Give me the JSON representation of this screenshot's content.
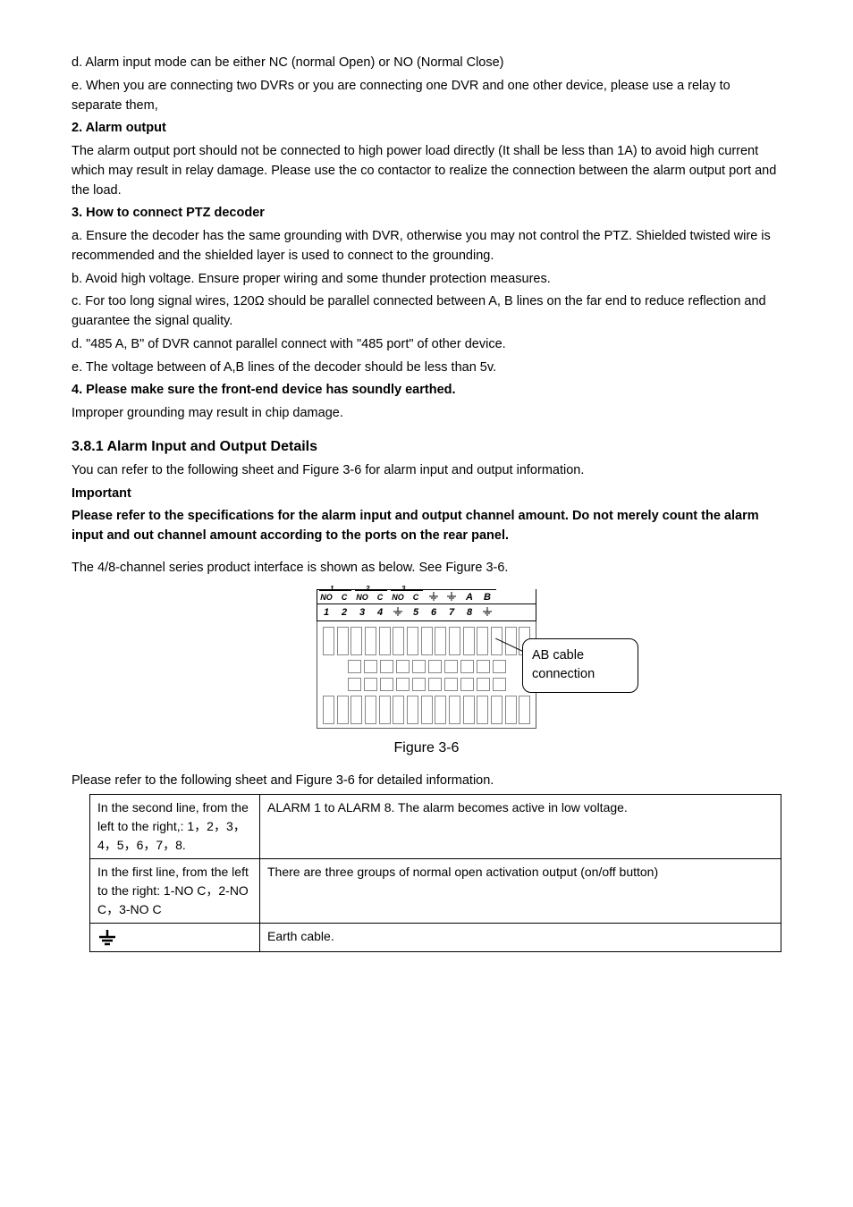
{
  "intro": {
    "d": "d. Alarm input mode can be either NC (normal Open) or NO (Normal Close)",
    "e": "e. When you are connecting two DVRs or you are connecting one DVR and one other device, please use a relay to separate them,"
  },
  "sec2": {
    "title": "2. Alarm output",
    "p1": "The alarm output port should not be connected to high power load directly (It shall be less than 1A) to avoid high current which may result in relay damage. Please use the co contactor to realize the connection between the alarm output port and the load."
  },
  "sec3": {
    "title": "3. How to connect PTZ decoder",
    "a": "a. Ensure the decoder has the same grounding with DVR, otherwise you may not control the PTZ. Shielded twisted wire is recommended and the shielded layer is used to connect to the grounding.",
    "b": "b. Avoid high voltage. Ensure proper wiring and some thunder protection measures.",
    "c": "c. For too long signal wires, 120Ω should be parallel connected between A, B lines on the far end to reduce reflection and guarantee the signal quality.",
    "d": "d. \"485 A, B\" of DVR cannot parallel connect with \"485 port\" of other device.",
    "e": "e. The voltage between of A,B lines of the decoder should be less than 5v."
  },
  "sec4": {
    "title": "4. Please make sure the front-end device has soundly earthed.",
    "p": "Improper grounding may result in chip damage."
  },
  "sec381": {
    "title": "3.8.1  Alarm Input and Output Details",
    "p1": "You can refer to the following sheet and Figure 3-6 for alarm input and output information.",
    "imp": "Important",
    "p2": "Please refer to the specifications for the alarm input and output channel amount. Do not merely count the alarm input and out channel amount according to the ports on the rear panel.",
    "p3": "The 4/8-channel series product interface is shown as below. See Figure 3-6."
  },
  "diagram": {
    "top_labels": [
      "NO",
      "C",
      "NO",
      "C",
      "NO",
      "C",
      "⏚",
      "⏚",
      "A",
      "B"
    ],
    "top_nums": [
      "1",
      "2",
      "3"
    ],
    "bot_labels": [
      "1",
      "2",
      "3",
      "4",
      "⏚",
      "5",
      "6",
      "7",
      "8",
      "⏚"
    ],
    "callout": "AB cable connection"
  },
  "figcap": "Figure 3-6",
  "tablelead": "Please refer to the following sheet and Figure 3-6 for detailed information.",
  "table": {
    "r1c1": "In the second  line, from the left to the right,: 1，2，3，4，5，6，7，8.",
    "r1c2": "ALARM 1 to ALARM 8. The alarm becomes active in low voltage.",
    "r2c1": "In the first  line, from the left to the right: 1-NO C，2-NO C，3-NO C",
    "r2c2": "There are three groups of normal open activation output (on/off button)",
    "r3c2": "Earth cable."
  }
}
